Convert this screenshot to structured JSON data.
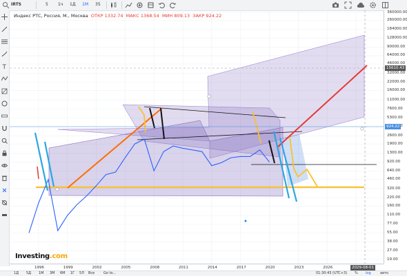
{
  "toolbar": {
    "symbol": "IRTS",
    "intervals": [
      "5",
      "1ч",
      "1Д",
      "1Н",
      "35"
    ],
    "active_interval": "1М"
  },
  "legend": {
    "title": "Индекс РТС, Россия, М., Москва",
    "open_label": "ОТКР",
    "open": "1332.74",
    "high_label": "МАКС",
    "high": "1368.54",
    "low_label": "МИН",
    "low": "809.13",
    "close_label": "ЗАКР",
    "close": "924.22"
  },
  "price_axis": {
    "labels": [
      "360000.00",
      "260000.00",
      "184000.00",
      "128000.00",
      "90000.00",
      "64000.00",
      "46000.00",
      "32000.00",
      "22000.00",
      "16000.00",
      "11000.00",
      "7600.00",
      "5300.00",
      "3800.00",
      "2600.00",
      "1900.00",
      "1300.00",
      "920.00",
      "640.00",
      "460.00",
      "320.00",
      "220.00",
      "160.00",
      "110.00",
      "77.00",
      "55.00",
      "38.00",
      "27.00",
      "19.00"
    ],
    "crosshair_value": "15610.43",
    "last_value": "924.22",
    "last_color": "#4a90e2"
  },
  "time_axis": {
    "labels": [
      "1996",
      "1999",
      "2002",
      "2005",
      "2008",
      "2011",
      "2014",
      "2017",
      "2020",
      "2023",
      "2026",
      "2029"
    ],
    "crosshair_date": "2029-08-01"
  },
  "bottom_bar": {
    "ranges": [
      "1Д",
      "5Д",
      "1М",
      "3М",
      "6М",
      "1Г",
      "5Л",
      "Все"
    ],
    "goto": "Go to...",
    "time": "01:30:43 (UTC+3)",
    "pct": "%",
    "log": "log",
    "auto": "авто"
  },
  "watermark": {
    "text": "Investing",
    "suffix": ".com"
  },
  "chart_data": {
    "type": "line",
    "title": "Индекс РТС, Россия, М., Москва",
    "xlabel": "",
    "ylabel": "",
    "x": [
      "1995",
      "1996",
      "1997",
      "1998",
      "1999",
      "2000",
      "2001",
      "2002",
      "2003",
      "2004",
      "2005",
      "2006",
      "2007",
      "2008",
      "2009",
      "2010",
      "2011",
      "2012",
      "2013",
      "2014",
      "2015",
      "2016",
      "2017",
      "2018",
      "2019",
      "2020"
    ],
    "series": [
      {
        "values": [
          55,
          180,
          460,
          60,
          110,
          170,
          240,
          360,
          560,
          620,
          1100,
          1900,
          2300,
          650,
          1400,
          1750,
          1600,
          1500,
          1400,
          800,
          900,
          1100,
          1150,
          1150,
          1500,
          924
        ]
      }
    ],
    "yscale": "log",
    "ylim": [
      19,
      360000
    ],
    "xlim": [
      "1995",
      "2029"
    ],
    "grid": true,
    "colors": {
      "price": "#2962ff",
      "trend_red": "#e53935",
      "trend_orange": "#ff6d00",
      "yellow": "#fbc02d",
      "cyan": "#29a8e0",
      "black": "#111111",
      "channel_fill": "#b39ddb"
    }
  }
}
